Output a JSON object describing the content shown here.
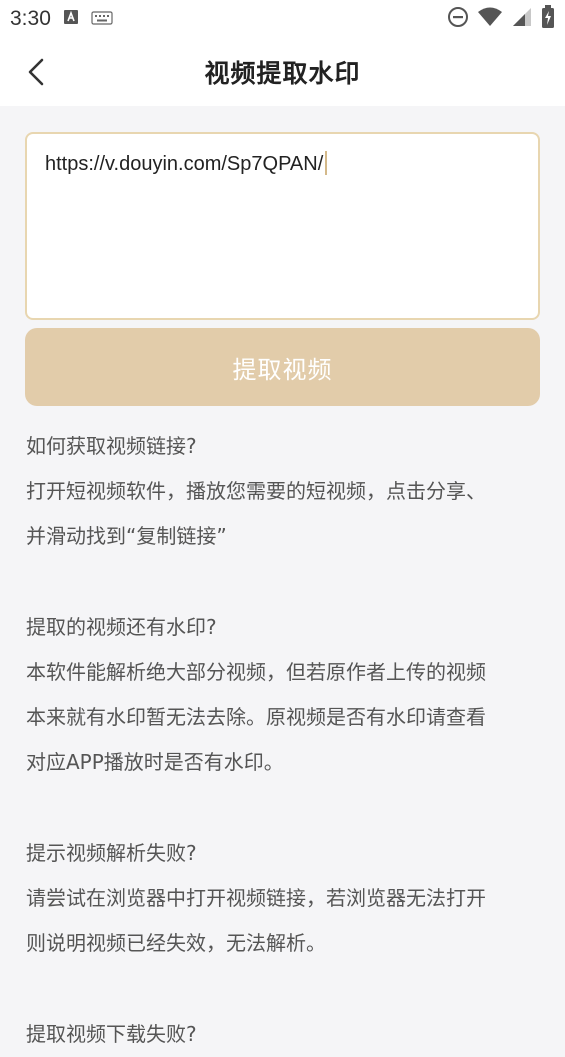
{
  "status_bar": {
    "time": "3:30"
  },
  "nav": {
    "title": "视频提取水印"
  },
  "input": {
    "value": "https://v.douyin.com/Sp7QPAN/"
  },
  "extract_button": {
    "label": "提取视频"
  },
  "faq": [
    {
      "question": "如何获取视频链接?",
      "answer_lines": [
        "打开短视频软件，播放您需要的短视频，点击分享、",
        "并滑动找到“复制链接”"
      ]
    },
    {
      "question": "提取的视频还有水印?",
      "answer_lines": [
        "本软件能解析绝大部分视频，但若原作者上传的视频",
        "本来就有水印暂无法去除。原视频是否有水印请查看",
        "对应APP播放时是否有水印。"
      ]
    },
    {
      "question": "提示视频解析失败?",
      "answer_lines": [
        "请尝试在浏览器中打开视频链接，若浏览器无法打开",
        "则说明视频已经失效，无法解析。"
      ]
    },
    {
      "question": "提取视频下载失败?"
    }
  ],
  "colors": {
    "accent": "#e2ccaa",
    "accent_border": "#e8d6b0",
    "page_bg": "#f5f5f7"
  }
}
